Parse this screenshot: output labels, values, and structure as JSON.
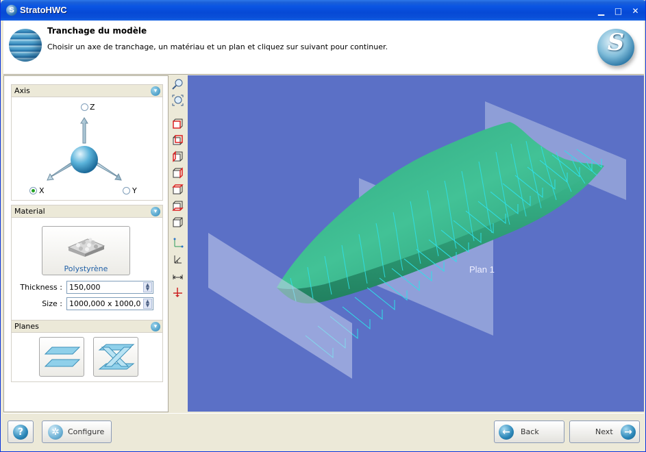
{
  "window": {
    "title": "StratoHWC",
    "app_icon_glyph": "S",
    "minimize_glyph": "▁",
    "maximize_glyph": "□",
    "close_glyph": "✕"
  },
  "header": {
    "title": "Tranchage du modèle",
    "description": "Choisir un axe de tranchage, un matériau et un plan et cliquez sur suivant pour continuer.",
    "logo_glyph": "S"
  },
  "axis_group": {
    "title": "Axis",
    "options": {
      "z": "Z",
      "x": "X",
      "y": "Y"
    },
    "selected": "X"
  },
  "material_group": {
    "title": "Material",
    "material_name": "Polystyrène",
    "thickness_label": "Thickness :",
    "thickness_value": "150,000",
    "size_label": "Size :",
    "size_value": "1000,000 x 1000,0"
  },
  "planes_group": {
    "title": "Planes"
  },
  "viewport": {
    "plane_label": "Plan 1",
    "background_color": "#5b70c6",
    "hull_color": "#3ab58a",
    "slice_color": "#2fe0e8"
  },
  "footer": {
    "help_glyph": "?",
    "configure_label": "Configure",
    "back_label": "Back",
    "next_label": "Next"
  },
  "icons": {
    "chevron": "chevron-down-icon",
    "toolbar": [
      "zoom-icon",
      "zoom-fit-icon",
      "view-front-icon",
      "view-back-icon",
      "view-left-icon",
      "view-right-icon",
      "view-top-icon",
      "view-bottom-icon",
      "view-iso-icon",
      "axis-icon",
      "rotate-axis-icon",
      "measure-icon",
      "reset-axis-icon"
    ]
  }
}
